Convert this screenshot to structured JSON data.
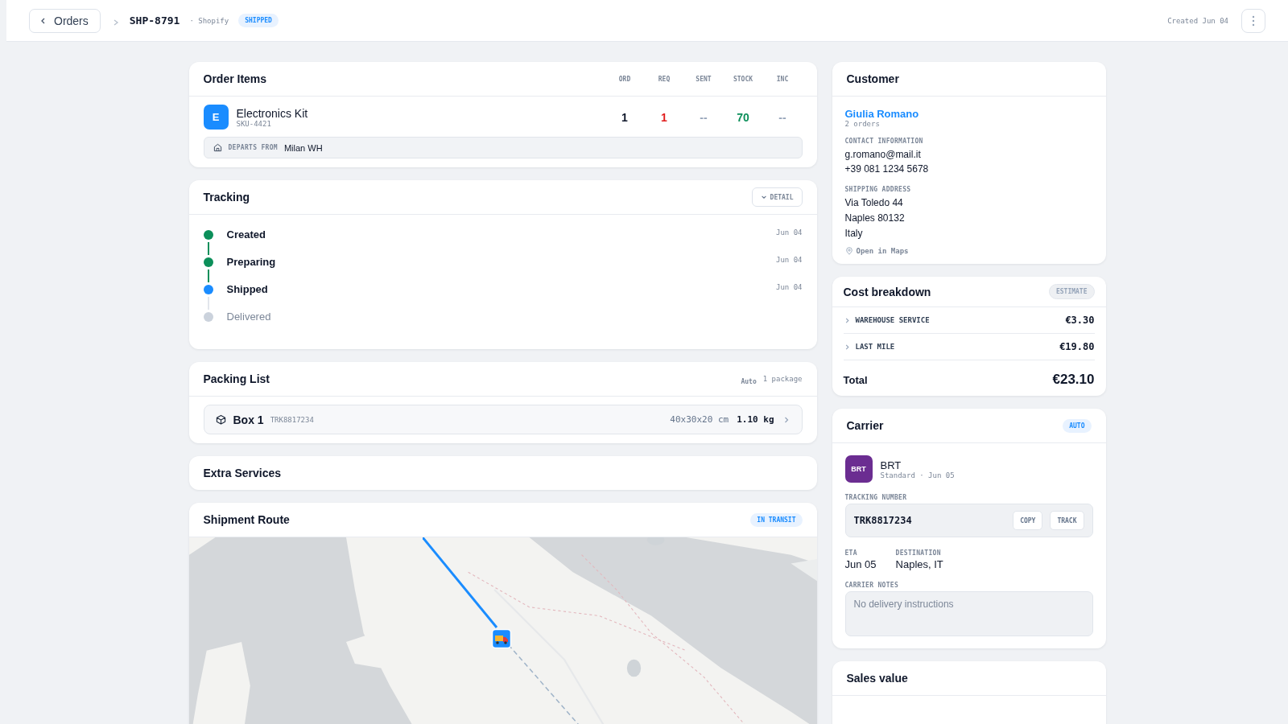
{
  "topbar": {
    "back": "Orders",
    "order_id": "SHP-8791",
    "source": "· Shopify",
    "status": "SHIPPED",
    "created": "Created Jun 04"
  },
  "order_items": {
    "title": "Order Items",
    "columns": [
      "ORD",
      "REQ",
      "SENT",
      "STOCK",
      "INC"
    ],
    "items": [
      {
        "initial": "E",
        "name": "Electronics Kit",
        "sku": "SKU-4421",
        "values": [
          {
            "text": "1",
            "color": "#0f172a"
          },
          {
            "text": "1",
            "color": "#e11d1d"
          },
          {
            "text": "--",
            "color": "#94a3b8"
          },
          {
            "text": "70",
            "color": "#0c8f5a"
          },
          {
            "text": "--",
            "color": "#94a3b8"
          }
        ],
        "departs_label": "DEPARTS FROM",
        "departs": "Milan WH"
      }
    ]
  },
  "tracking": {
    "title": "Tracking",
    "detail": "DETAIL",
    "steps": [
      {
        "label": "Created",
        "date": "Jun 04",
        "kind": "done"
      },
      {
        "label": "Preparing",
        "date": "Jun 04",
        "kind": "done"
      },
      {
        "label": "Shipped",
        "date": "Jun 04",
        "kind": "current"
      },
      {
        "label": "Delivered",
        "kind": "pending"
      }
    ]
  },
  "packing": {
    "title": "Packing List",
    "mode": "Auto",
    "count": "1 package",
    "boxes": [
      {
        "name": "Box 1",
        "tracking": "TRK8817234",
        "dims": "40x30x20 cm",
        "weight": "1.10 kg"
      }
    ]
  },
  "extra_services": {
    "title": "Extra Services"
  },
  "route": {
    "title": "Shipment Route",
    "status": "IN TRANSIT"
  },
  "customer": {
    "title": "Customer",
    "name": "Giulia Romano",
    "orders": "2 orders",
    "contact_label": "CONTACT INFORMATION",
    "contact": [
      "g.romano@mail.it",
      "+39 081 1234 5678"
    ],
    "address_label": "SHIPPING ADDRESS",
    "address": [
      "Via Toledo 44",
      "Naples 80132",
      "Italy"
    ],
    "maps_link": "Open in Maps"
  },
  "costs": {
    "title": "Cost breakdown",
    "badge": "ESTIMATE",
    "lines": [
      {
        "label": "WAREHOUSE SERVICE",
        "amount": "€3.30",
        "expanded": false
      },
      {
        "label": "LAST MILE",
        "amount": "€19.80",
        "expanded": false
      }
    ],
    "total_label": "Total",
    "total": "€23.10"
  },
  "carrier": {
    "title": "Carrier",
    "badge": "AUTO",
    "logo": "BRT",
    "name": "BRT",
    "service": "Standard · Jun 05",
    "tracking_label": "TRACKING NUMBER",
    "tracking": "TRK8817234",
    "copy": "COPY",
    "track": "TRACK",
    "eta_label": "ETA",
    "eta": "Jun 05",
    "dest_label": "DESTINATION",
    "dest": "Naples, IT",
    "notes_label": "CARRIER NOTES",
    "notes_placeholder": "No delivery instructions"
  },
  "sales": {
    "title": "Sales value"
  }
}
